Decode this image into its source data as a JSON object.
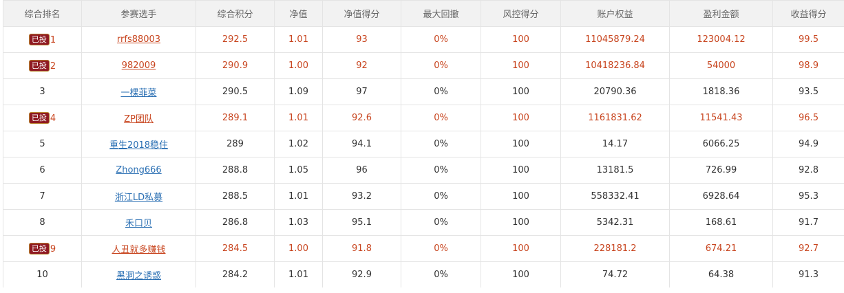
{
  "headers": [
    "综合排名",
    "参赛选手",
    "综合积分",
    "净值",
    "净值得分",
    "最大回撤",
    "风控得分",
    "账户权益",
    "盈利金额",
    "收益得分"
  ],
  "badge_label": "已投",
  "highlight_color": "#c8451f",
  "link_color": "#2a6fb3",
  "badge_color": "#8f1a22",
  "rows": [
    {
      "rank": "1",
      "invested": true,
      "name": "rrfs88003",
      "score": "292.5",
      "nav": "1.01",
      "nav_score": "93",
      "drawdown": "0%",
      "risk_score": "100",
      "equity": "11045879.24",
      "profit": "123004.12",
      "return_score": "99.5"
    },
    {
      "rank": "2",
      "invested": true,
      "name": "982009",
      "score": "290.9",
      "nav": "1.00",
      "nav_score": "92",
      "drawdown": "0%",
      "risk_score": "100",
      "equity": "10418236.84",
      "profit": "54000",
      "return_score": "98.9"
    },
    {
      "rank": "3",
      "invested": false,
      "name": "一棵菲菜",
      "score": "290.5",
      "nav": "1.09",
      "nav_score": "97",
      "drawdown": "0%",
      "risk_score": "100",
      "equity": "20790.36",
      "profit": "1818.36",
      "return_score": "93.5"
    },
    {
      "rank": "4",
      "invested": true,
      "name": "ZP团队",
      "score": "289.1",
      "nav": "1.01",
      "nav_score": "92.6",
      "drawdown": "0%",
      "risk_score": "100",
      "equity": "1161831.62",
      "profit": "11541.43",
      "return_score": "96.5"
    },
    {
      "rank": "5",
      "invested": false,
      "name": "重生2018稳住",
      "score": "289",
      "nav": "1.02",
      "nav_score": "94.1",
      "drawdown": "0%",
      "risk_score": "100",
      "equity": "14.17",
      "profit": "6066.25",
      "return_score": "94.9"
    },
    {
      "rank": "6",
      "invested": false,
      "name": "Zhong666",
      "score": "288.8",
      "nav": "1.05",
      "nav_score": "96",
      "drawdown": "0%",
      "risk_score": "100",
      "equity": "13181.5",
      "profit": "726.99",
      "return_score": "92.8"
    },
    {
      "rank": "7",
      "invested": false,
      "name": "浙江LD私募",
      "score": "288.5",
      "nav": "1.01",
      "nav_score": "93.2",
      "drawdown": "0%",
      "risk_score": "100",
      "equity": "558332.41",
      "profit": "6928.64",
      "return_score": "95.3"
    },
    {
      "rank": "8",
      "invested": false,
      "name": "禾口贝",
      "score": "286.8",
      "nav": "1.03",
      "nav_score": "95.1",
      "drawdown": "0%",
      "risk_score": "100",
      "equity": "5342.31",
      "profit": "168.61",
      "return_score": "91.7"
    },
    {
      "rank": "9",
      "invested": true,
      "name": "人丑就多赚钱",
      "score": "284.5",
      "nav": "1.00",
      "nav_score": "91.8",
      "drawdown": "0%",
      "risk_score": "100",
      "equity": "228181.2",
      "profit": "674.21",
      "return_score": "92.7"
    },
    {
      "rank": "10",
      "invested": false,
      "name": "黑洞之诱惑",
      "score": "284.2",
      "nav": "1.01",
      "nav_score": "92.9",
      "drawdown": "0%",
      "risk_score": "100",
      "equity": "74.72",
      "profit": "64.38",
      "return_score": "91.3"
    }
  ]
}
